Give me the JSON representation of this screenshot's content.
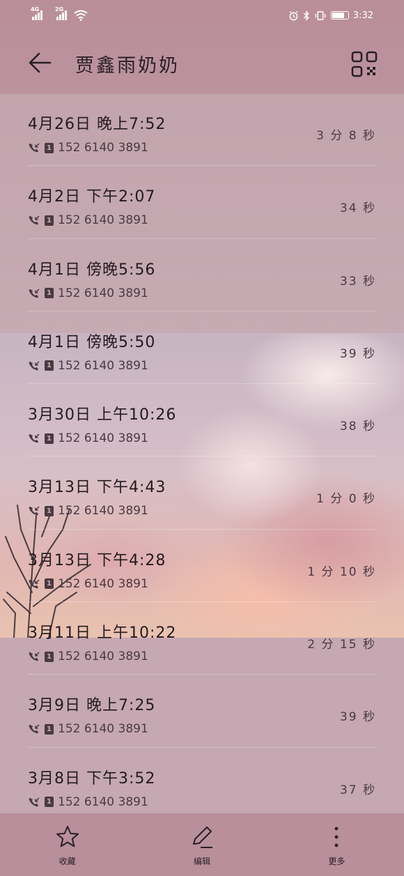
{
  "status_bar": {
    "net1": "4G",
    "net2": "2G",
    "time": "3:32"
  },
  "header": {
    "title": "贾鑫雨奶奶"
  },
  "calls": [
    {
      "date": "4月26日 晚上7:52",
      "number": "152 6140 3891",
      "duration": "3 分 8 秒",
      "sim": "1"
    },
    {
      "date": "4月2日 下午2:07",
      "number": "152 6140 3891",
      "duration": "34 秒",
      "sim": "1"
    },
    {
      "date": "4月1日 傍晚5:56",
      "number": "152 6140 3891",
      "duration": "33 秒",
      "sim": "1"
    },
    {
      "date": "4月1日 傍晚5:50",
      "number": "152 6140 3891",
      "duration": "39 秒",
      "sim": "1"
    },
    {
      "date": "3月30日 上午10:26",
      "number": "152 6140 3891",
      "duration": "38 秒",
      "sim": "1"
    },
    {
      "date": "3月13日 下午4:43",
      "number": "152 6140 3891",
      "duration": "1 分 0 秒",
      "sim": "1"
    },
    {
      "date": "3月13日 下午4:28",
      "number": "152 6140 3891",
      "duration": "1 分 10 秒",
      "sim": "1"
    },
    {
      "date": "3月11日 上午10:22",
      "number": "152 6140 3891",
      "duration": "2 分 15 秒",
      "sim": "1"
    },
    {
      "date": "3月9日 晚上7:25",
      "number": "152 6140 3891",
      "duration": "39 秒",
      "sim": "1"
    },
    {
      "date": "3月8日 下午3:52",
      "number": "152 6140 3891",
      "duration": "37 秒",
      "sim": "1"
    }
  ],
  "bottom_bar": {
    "favorite_label": "收藏",
    "edit_label": "编辑",
    "more_label": "更多"
  }
}
